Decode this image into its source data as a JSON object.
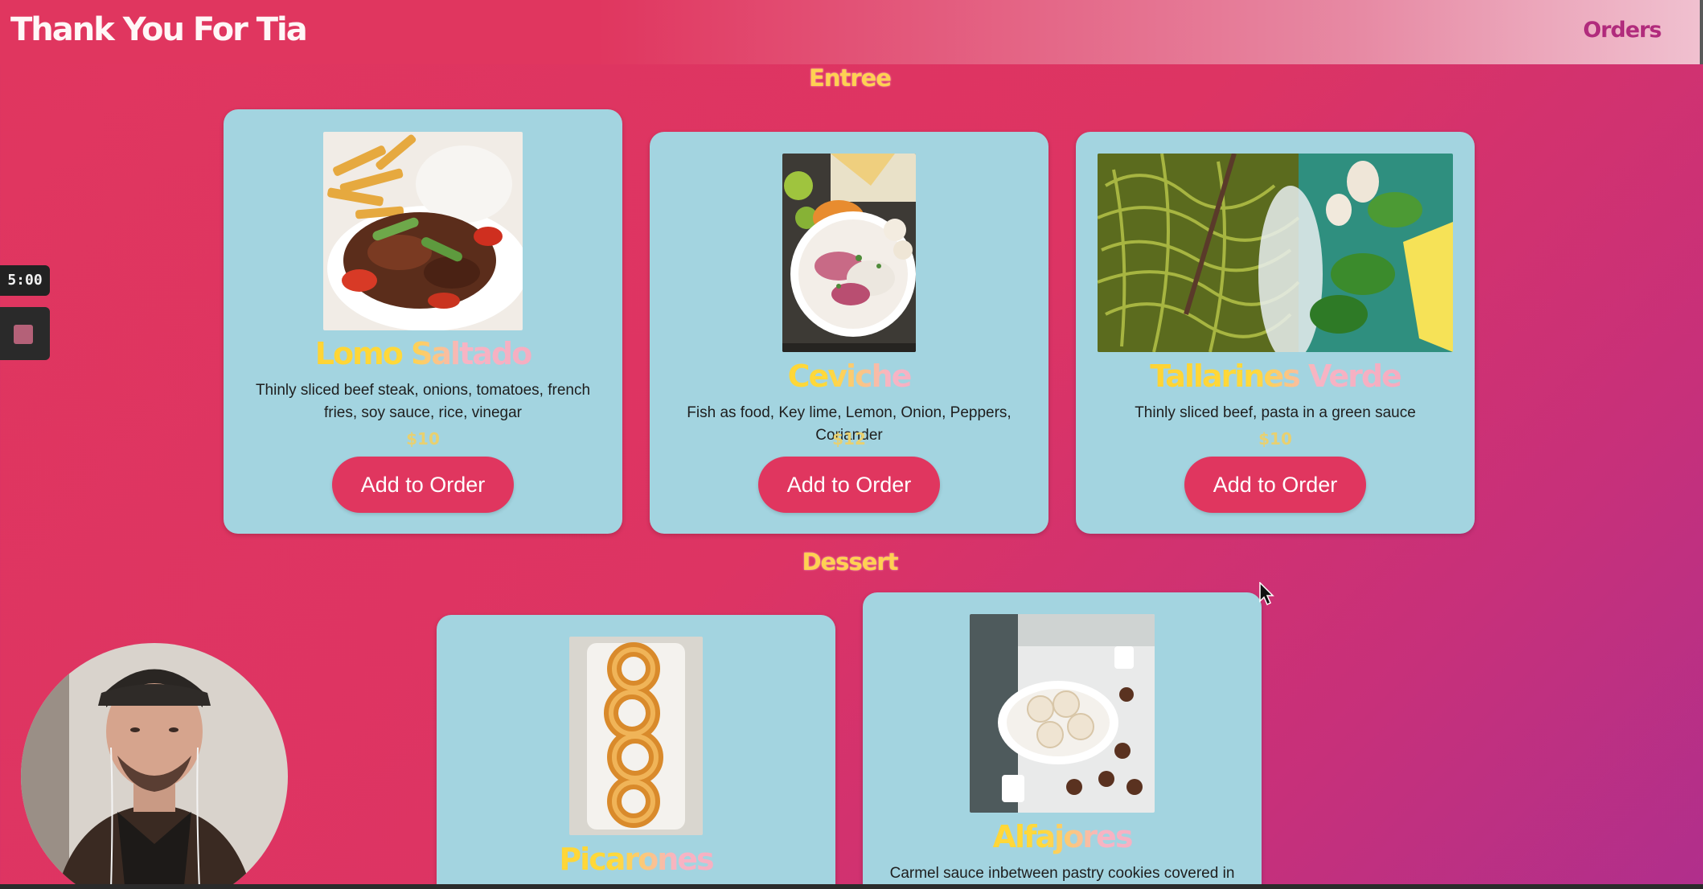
{
  "header": {
    "brand": "Thank You For Tia",
    "orders_link": "Orders"
  },
  "sections": [
    {
      "title": "Entree",
      "items": [
        {
          "name": "Lomo Saltado",
          "description": "Thinly sliced beef steak, onions, tomatoes, french fries, soy sauce, rice, vinegar",
          "price": "$10",
          "button": "Add to Order"
        },
        {
          "name": "Ceviche",
          "description": "Fish as food, Key lime, Lemon, Onion, Peppers, Coriander",
          "price": "$12",
          "button": "Add to Order"
        },
        {
          "name": "Tallarines Verde",
          "description": "Thinly sliced beef, pasta in a green sauce",
          "price": "$10",
          "button": "Add to Order"
        }
      ]
    },
    {
      "title": "Dessert",
      "items": [
        {
          "name": "Picarones",
          "description": "",
          "price": "",
          "button": ""
        },
        {
          "name": "Alfajores",
          "description": "Carmel sauce inbetween pastry cookies covered in",
          "price": "",
          "button": ""
        }
      ]
    }
  ],
  "recorder": {
    "timer": "5:00"
  },
  "colors": {
    "background": "#dd3463",
    "card": "#a3d4e0",
    "button": "#e0365f",
    "title_yellow": "#ffd152",
    "orders_link": "#b12b7c"
  }
}
